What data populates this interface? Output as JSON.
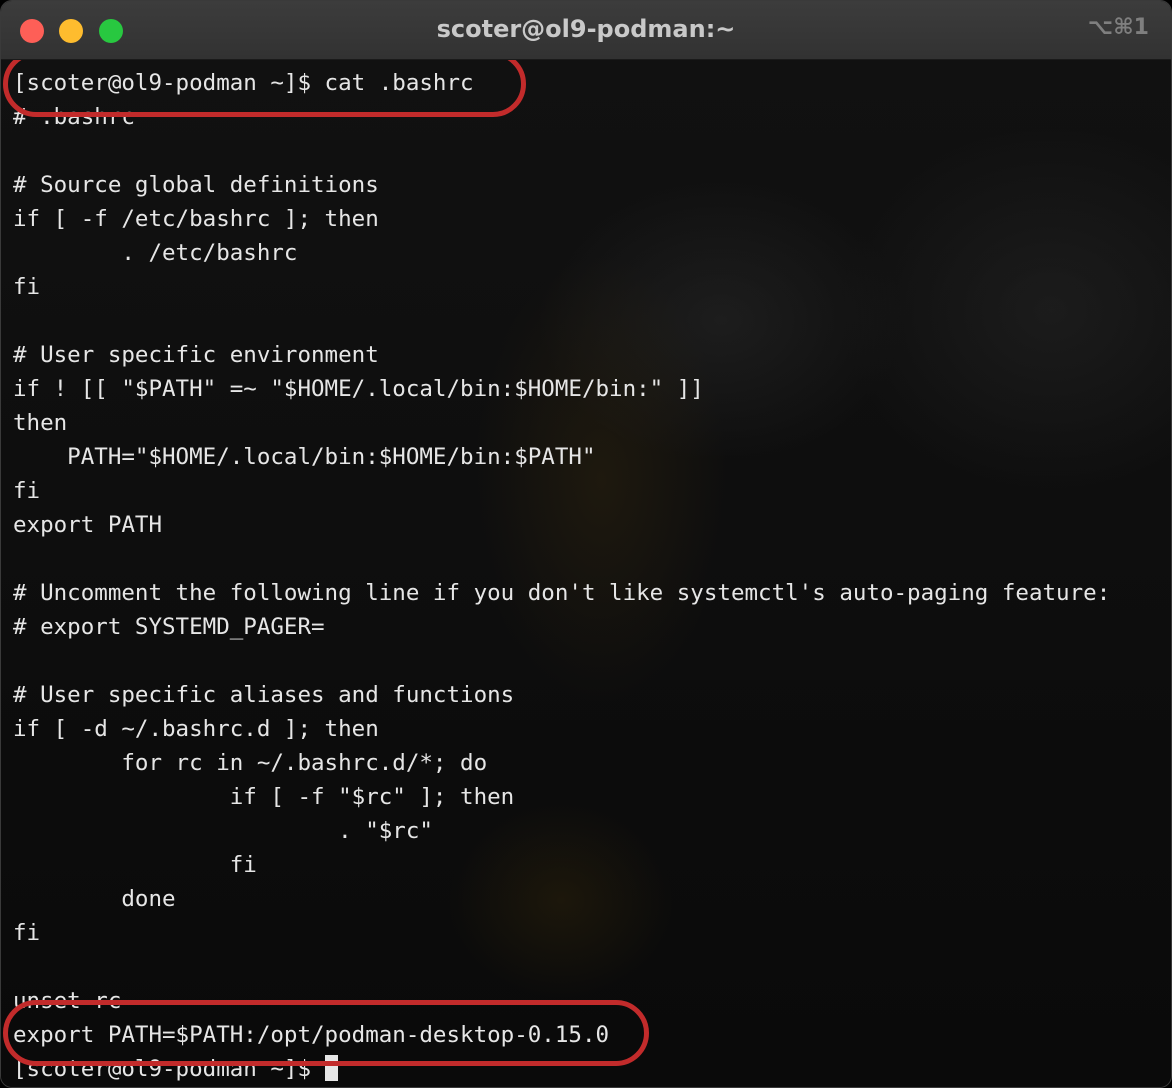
{
  "window": {
    "title": "scoter@ol9-podman:~",
    "shortcut": "⌥⌘1"
  },
  "colors": {
    "highlight": "#c22b2b",
    "close": "#fe5f57",
    "minimize": "#febc2e",
    "maximize": "#28c840"
  },
  "terminal": {
    "lines": [
      "[scoter@ol9-podman ~]$ cat .bashrc",
      "# .bashrc",
      "",
      "# Source global definitions",
      "if [ -f /etc/bashrc ]; then",
      "        . /etc/bashrc",
      "fi",
      "",
      "# User specific environment",
      "if ! [[ \"$PATH\" =~ \"$HOME/.local/bin:$HOME/bin:\" ]]",
      "then",
      "    PATH=\"$HOME/.local/bin:$HOME/bin:$PATH\"",
      "fi",
      "export PATH",
      "",
      "# Uncomment the following line if you don't like systemctl's auto-paging feature:",
      "# export SYSTEMD_PAGER=",
      "",
      "# User specific aliases and functions",
      "if [ -d ~/.bashrc.d ]; then",
      "        for rc in ~/.bashrc.d/*; do",
      "                if [ -f \"$rc\" ]; then",
      "                        . \"$rc\"",
      "                fi",
      "        done",
      "fi",
      "",
      "unset rc",
      "export PATH=$PATH:/opt/podman-desktop-0.15.0",
      "[scoter@ol9-podman ~]$ "
    ]
  }
}
